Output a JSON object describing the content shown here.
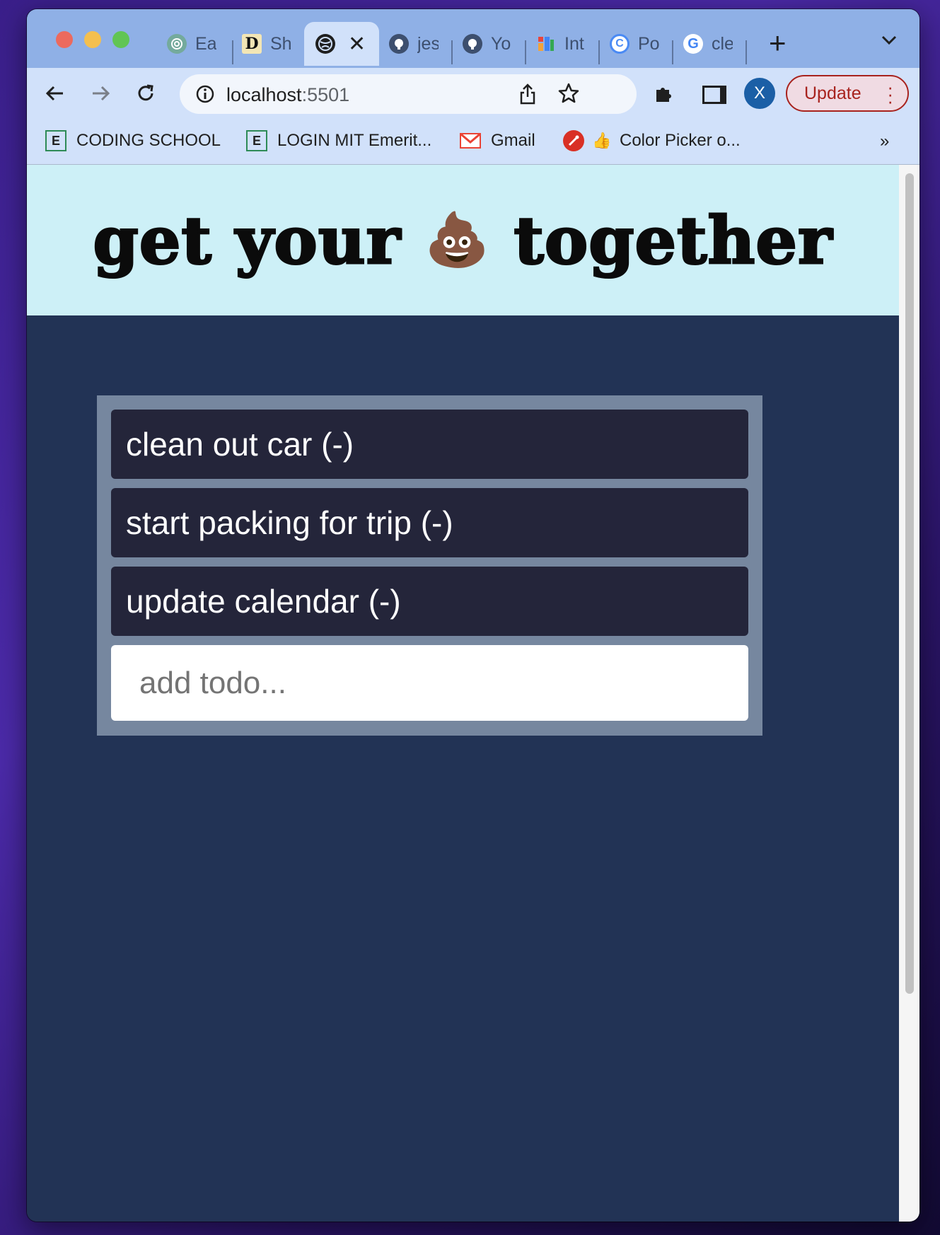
{
  "browser": {
    "tabs": [
      {
        "title": "Ea",
        "icon": "openai-icon"
      },
      {
        "title": "Sh",
        "icon": "d-logo-icon"
      },
      {
        "title": "",
        "icon": "globe-icon",
        "active": true
      },
      {
        "title": "jes",
        "icon": "github-icon"
      },
      {
        "title": "Yo",
        "icon": "github-icon"
      },
      {
        "title": "Int",
        "icon": "colorful-logo-icon"
      },
      {
        "title": "Po",
        "icon": "c-logo-icon"
      },
      {
        "title": "cle",
        "icon": "google-icon"
      }
    ],
    "address": {
      "host": "localhost",
      "port": ":5501"
    },
    "profile_initial": "X",
    "update_label": "Update",
    "bookmarks": [
      {
        "label": "CODING SCHOOL",
        "icon": "e-icon"
      },
      {
        "label": "LOGIN MIT Emerit...",
        "icon": "e-icon"
      },
      {
        "label": "Gmail",
        "icon": "gmail-icon"
      },
      {
        "label": "Color Picker o...",
        "icon": "thumbs-up-icon"
      }
    ],
    "bookmarks_overflow": "»"
  },
  "page": {
    "heading_before": "get your",
    "heading_emoji": "💩",
    "heading_after": "together",
    "todos": [
      "clean out car (-)",
      "start packing for trip (-)",
      "update calendar (-)"
    ],
    "input_placeholder": "add todo...",
    "input_value": ""
  },
  "colors": {
    "hero_bg": "#cdf0f7",
    "page_bg": "#223355",
    "todo_panel": "#76879f",
    "todo_item": "#24253a",
    "update_accent": "#a8231e"
  }
}
